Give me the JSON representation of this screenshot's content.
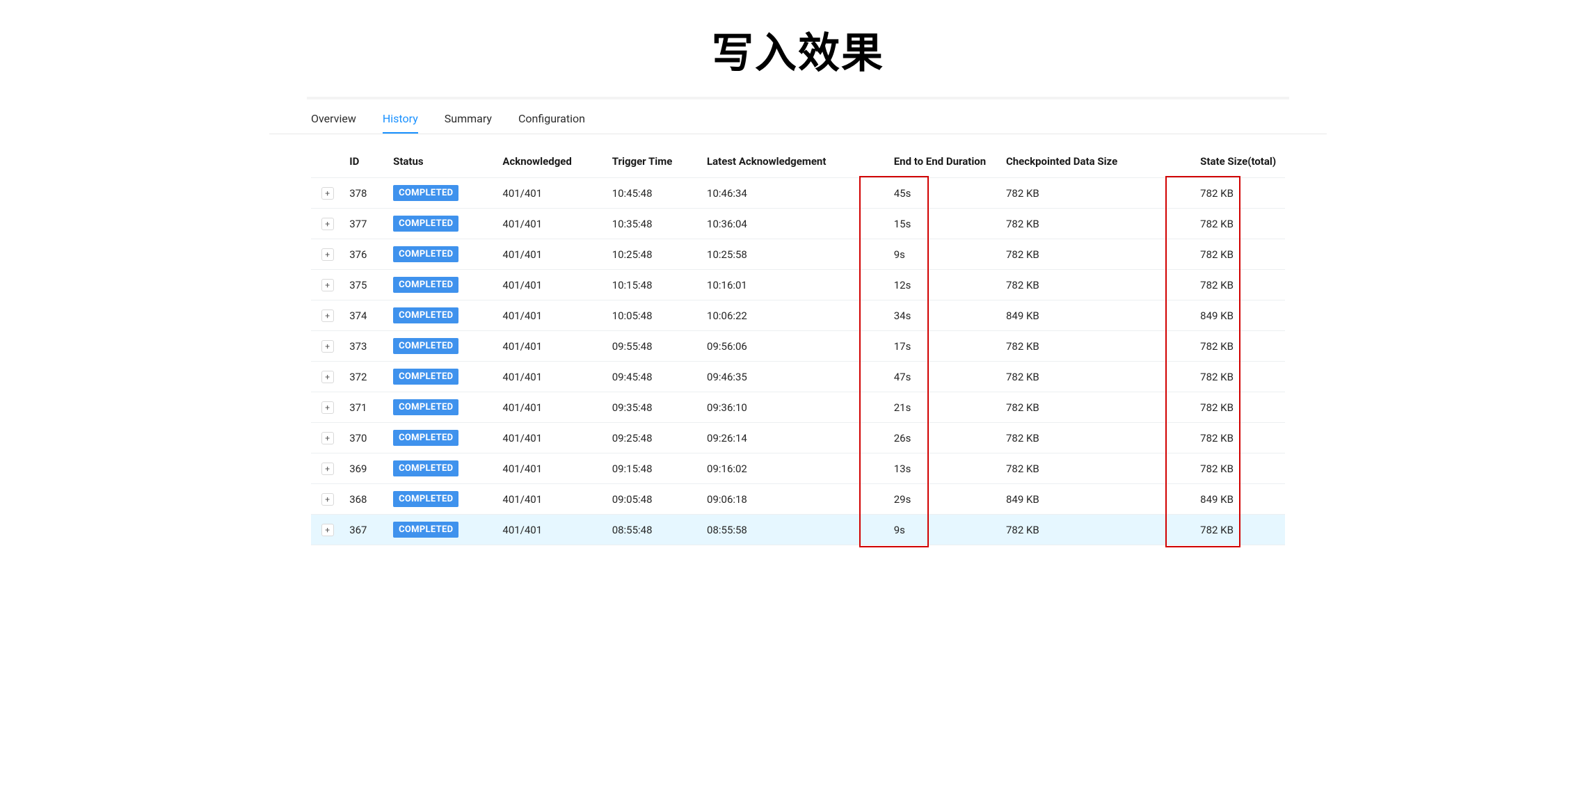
{
  "page_title": "写入效果",
  "tabs": [
    {
      "label": "Overview",
      "active": false
    },
    {
      "label": "History",
      "active": true
    },
    {
      "label": "Summary",
      "active": false
    },
    {
      "label": "Configuration",
      "active": false
    }
  ],
  "columns": {
    "expand": "",
    "id": "ID",
    "status": "Status",
    "ack": "Acknowledged",
    "trigger": "Trigger Time",
    "latest_ack": "Latest Acknowledgement",
    "duration": "End to End Duration",
    "cds": "Checkpointed Data Size",
    "state_size": "State Size(total)"
  },
  "rows": [
    {
      "id": "378",
      "status": "COMPLETED",
      "ack": "401/401",
      "trigger": "10:45:48",
      "latest_ack": "10:46:34",
      "duration": "45s",
      "cds": "782 KB",
      "state_size": "782 KB",
      "highlight": false
    },
    {
      "id": "377",
      "status": "COMPLETED",
      "ack": "401/401",
      "trigger": "10:35:48",
      "latest_ack": "10:36:04",
      "duration": "15s",
      "cds": "782 KB",
      "state_size": "782 KB",
      "highlight": false
    },
    {
      "id": "376",
      "status": "COMPLETED",
      "ack": "401/401",
      "trigger": "10:25:48",
      "latest_ack": "10:25:58",
      "duration": "9s",
      "cds": "782 KB",
      "state_size": "782 KB",
      "highlight": false
    },
    {
      "id": "375",
      "status": "COMPLETED",
      "ack": "401/401",
      "trigger": "10:15:48",
      "latest_ack": "10:16:01",
      "duration": "12s",
      "cds": "782 KB",
      "state_size": "782 KB",
      "highlight": false
    },
    {
      "id": "374",
      "status": "COMPLETED",
      "ack": "401/401",
      "trigger": "10:05:48",
      "latest_ack": "10:06:22",
      "duration": "34s",
      "cds": "849 KB",
      "state_size": "849 KB",
      "highlight": false
    },
    {
      "id": "373",
      "status": "COMPLETED",
      "ack": "401/401",
      "trigger": "09:55:48",
      "latest_ack": "09:56:06",
      "duration": "17s",
      "cds": "782 KB",
      "state_size": "782 KB",
      "highlight": false
    },
    {
      "id": "372",
      "status": "COMPLETED",
      "ack": "401/401",
      "trigger": "09:45:48",
      "latest_ack": "09:46:35",
      "duration": "47s",
      "cds": "782 KB",
      "state_size": "782 KB",
      "highlight": false
    },
    {
      "id": "371",
      "status": "COMPLETED",
      "ack": "401/401",
      "trigger": "09:35:48",
      "latest_ack": "09:36:10",
      "duration": "21s",
      "cds": "782 KB",
      "state_size": "782 KB",
      "highlight": false
    },
    {
      "id": "370",
      "status": "COMPLETED",
      "ack": "401/401",
      "trigger": "09:25:48",
      "latest_ack": "09:26:14",
      "duration": "26s",
      "cds": "782 KB",
      "state_size": "782 KB",
      "highlight": false
    },
    {
      "id": "369",
      "status": "COMPLETED",
      "ack": "401/401",
      "trigger": "09:15:48",
      "latest_ack": "09:16:02",
      "duration": "13s",
      "cds": "782 KB",
      "state_size": "782 KB",
      "highlight": false
    },
    {
      "id": "368",
      "status": "COMPLETED",
      "ack": "401/401",
      "trigger": "09:05:48",
      "latest_ack": "09:06:18",
      "duration": "29s",
      "cds": "849 KB",
      "state_size": "849 KB",
      "highlight": false
    },
    {
      "id": "367",
      "status": "COMPLETED",
      "ack": "401/401",
      "trigger": "08:55:48",
      "latest_ack": "08:55:58",
      "duration": "9s",
      "cds": "782 KB",
      "state_size": "782 KB",
      "highlight": true
    }
  ],
  "expand_glyph": "+"
}
